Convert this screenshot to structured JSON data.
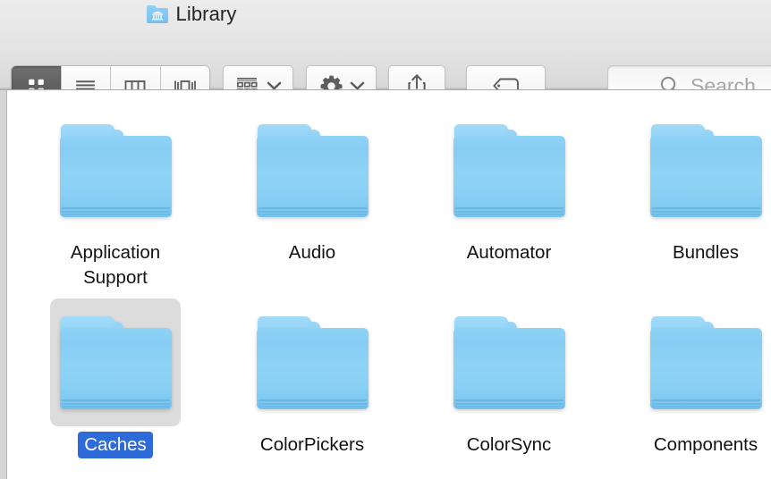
{
  "window": {
    "title": "Library",
    "title_icon": "library-folder-icon"
  },
  "toolbar": {
    "view_modes": [
      {
        "name": "icon-view",
        "icon": "grid-icon",
        "active": true
      },
      {
        "name": "list-view",
        "icon": "list-icon",
        "active": false
      },
      {
        "name": "column-view",
        "icon": "columns-icon",
        "active": false
      },
      {
        "name": "gallery-view",
        "icon": "gallery-icon",
        "active": false
      }
    ],
    "arrange_button": {
      "name": "arrange-button",
      "icon": "arrange-grid-icon",
      "chevron": "chevron-down-icon"
    },
    "action_button": {
      "name": "action-button",
      "icon": "gear-icon",
      "chevron": "chevron-down-icon"
    },
    "share_button": {
      "name": "share-button",
      "icon": "share-icon"
    },
    "tag_button": {
      "name": "tag-button",
      "icon": "tag-icon"
    },
    "search": {
      "name": "search-input",
      "icon": "search-icon",
      "placeholder": "Search",
      "value": ""
    }
  },
  "colors": {
    "selection_label": "#2f6ad9",
    "selection_icon_bg": "#dcdcdc",
    "folder_blue": "#8ed2f6",
    "toolbar_bg": "#e8e8e8",
    "content_bg": "#ffffff"
  },
  "files": [
    {
      "name": "Application Support",
      "label": "Application\nSupport",
      "icon": "folder-icon",
      "selected": false
    },
    {
      "name": "Audio",
      "label": "Audio",
      "icon": "folder-icon",
      "selected": false
    },
    {
      "name": "Automator",
      "label": "Automator",
      "icon": "folder-icon",
      "selected": false
    },
    {
      "name": "Bundles",
      "label": "Bundles",
      "icon": "folder-icon",
      "selected": false
    },
    {
      "name": "Caches",
      "label": "Caches",
      "icon": "folder-icon",
      "selected": true
    },
    {
      "name": "ColorPickers",
      "label": "ColorPickers",
      "icon": "folder-icon",
      "selected": false
    },
    {
      "name": "ColorSync",
      "label": "ColorSync",
      "icon": "folder-icon",
      "selected": false
    },
    {
      "name": "Components",
      "label": "Components",
      "icon": "folder-icon",
      "selected": false
    }
  ]
}
